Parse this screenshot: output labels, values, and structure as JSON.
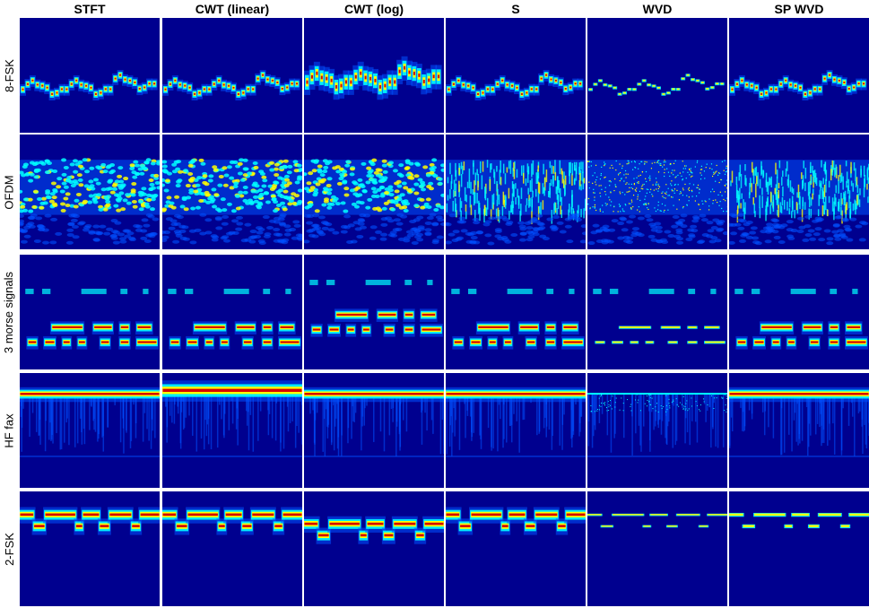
{
  "columns": [
    "STFT",
    "CWT (linear)",
    "CWT (log)",
    "S",
    "WVD",
    "SP WVD"
  ],
  "rows": [
    "8-FSK",
    "OFDM",
    "3 morse signals",
    "HF fax",
    "2-FSK"
  ],
  "colormap": {
    "background": "#00008f",
    "low": "#0050ff",
    "mid": "#00ffff",
    "high": "#ffff00",
    "peak": "#d40000"
  }
}
